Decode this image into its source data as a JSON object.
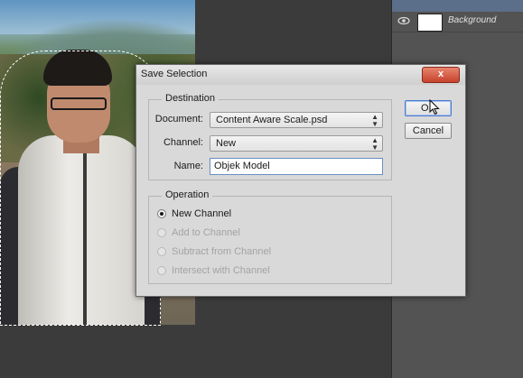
{
  "layers": {
    "items": [
      {
        "name": "",
        "active": true
      },
      {
        "name": "Background",
        "active": false
      }
    ]
  },
  "dialog": {
    "title": "Save Selection",
    "close_label": "x",
    "destination": {
      "legend": "Destination",
      "document_label": "Document:",
      "document_value": "Content Aware Scale.psd",
      "channel_label": "Channel:",
      "channel_value": "New",
      "name_label": "Name:",
      "name_value": "Objek Model"
    },
    "operation": {
      "legend": "Operation",
      "options": [
        {
          "label": "New Channel",
          "checked": true,
          "enabled": true
        },
        {
          "label": "Add to Channel",
          "checked": false,
          "enabled": false
        },
        {
          "label": "Subtract from Channel",
          "checked": false,
          "enabled": false
        },
        {
          "label": "Intersect with Channel",
          "checked": false,
          "enabled": false
        }
      ]
    },
    "ok_label": "OK",
    "cancel_label": "Cancel"
  },
  "icons": {
    "eye": "eye-icon",
    "dropdown": "dropdown-arrows-icon",
    "cursor": "mouse-pointer-icon"
  }
}
